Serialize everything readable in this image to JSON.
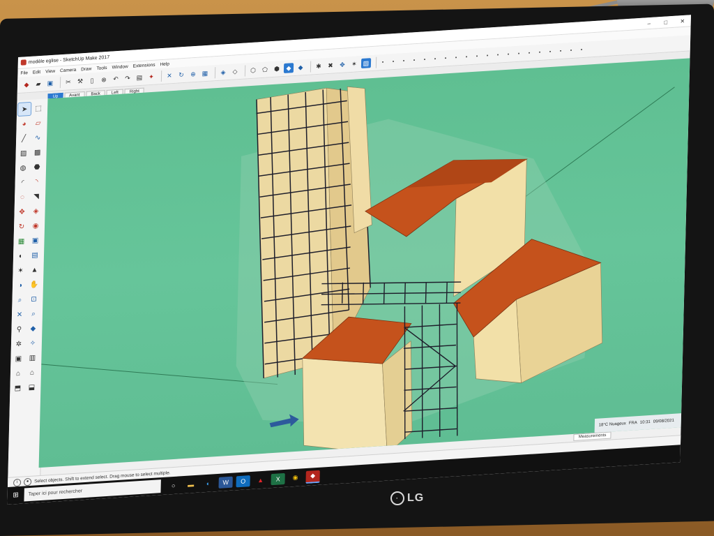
{
  "window": {
    "title": "modèle eglise - SketchUp Make 2017",
    "minimize": "–",
    "maximize": "□",
    "close": "✕"
  },
  "menu": [
    "File",
    "Edit",
    "View",
    "Camera",
    "Draw",
    "Tools",
    "Window",
    "Extensions",
    "Help"
  ],
  "scene_tabs": [
    "Up",
    "Avant",
    "Back",
    "Left",
    "Right"
  ],
  "active_tab_index": 0,
  "status": {
    "message": "Select objects. Shift to extend select. Drag mouse to select multiple."
  },
  "measurements_label": "Measurements",
  "tray": {
    "weather": "18°C Nuageux",
    "lang": "FRA",
    "time": "10:31",
    "date": "09/08/2021"
  },
  "taskbar": {
    "search_placeholder": "Taper ici pour rechercher"
  },
  "monitor_brand": "LG",
  "colors": {
    "viewport": "#63c297",
    "roof": "#c5521c",
    "wall": "#f2e0a8",
    "scaffold": "#1d1d2a",
    "accent": "#2b79d0"
  },
  "icons": {
    "toolbar": [
      "getting-started-icon",
      "open-icon",
      "save-icon",
      "select-icon",
      "paint-icon",
      "eraser-icon",
      "undo-icon",
      "redo-icon",
      "print-icon",
      "model-info-icon",
      "x-ray-icon",
      "orbit-icon",
      "zoom-extents-icon",
      "components-icon",
      "style-icon",
      "layers-icon"
    ],
    "palette": [
      "select-icon",
      "component-icon",
      "paint-bucket-icon",
      "eraser-icon",
      "line-icon",
      "freehand-icon",
      "rectangle-icon",
      "rotated-rect-icon",
      "circle-icon",
      "polygon-icon",
      "arc-icon",
      "pie-icon",
      "push-pull-icon",
      "follow-me-icon",
      "move-icon",
      "offset-icon",
      "rotate-icon",
      "scale-icon",
      "tape-icon",
      "dimension-icon",
      "protractor-icon",
      "text-icon",
      "axes-icon",
      "3d-text-icon",
      "orbit-icon",
      "pan-icon",
      "zoom-icon",
      "zoom-window-icon",
      "zoom-extents-icon",
      "position-camera-icon",
      "walk-icon",
      "look-around-icon",
      "section-plane-icon",
      "warehouse-icon",
      "extension-icon",
      "house-icon"
    ]
  }
}
